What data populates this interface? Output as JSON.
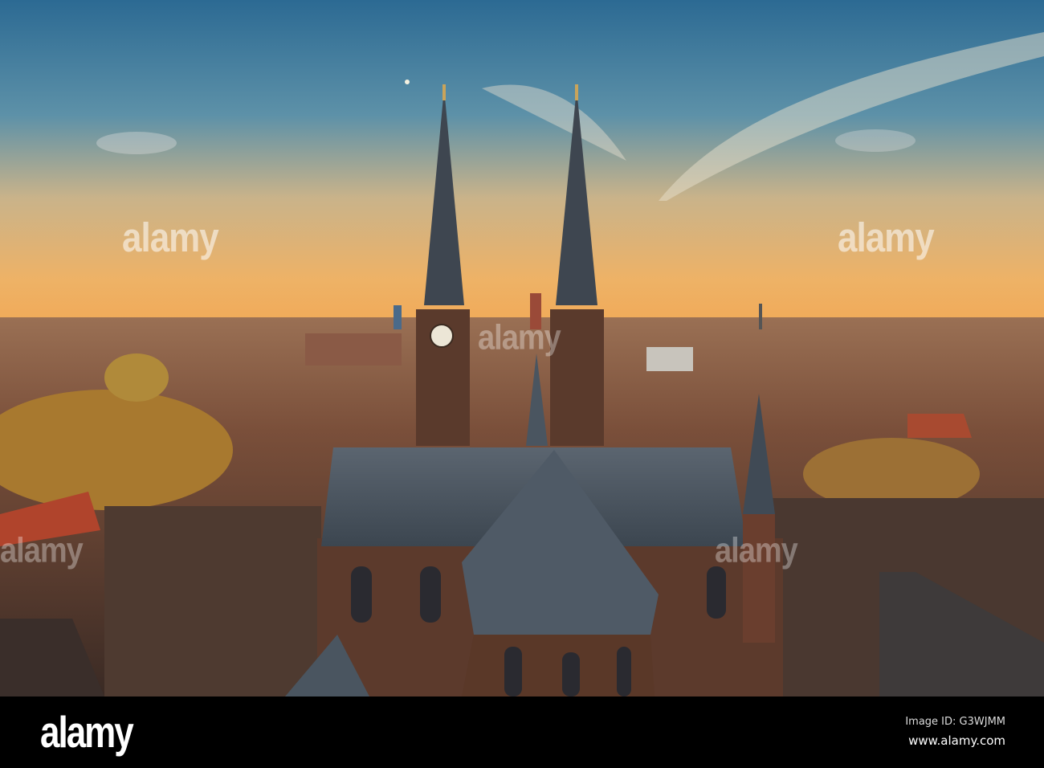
{
  "photo": {
    "subject": "church-with-twin-spires-over-city",
    "colors": {
      "sky_top": "#2f6f96",
      "sky_mid": "#8fa9a8",
      "horizon": "#f0b061",
      "roof": "#4a5560",
      "brick": "#5a3a2c",
      "trees": "#b07a2a"
    }
  },
  "watermark": {
    "text": "alamy"
  },
  "footer": {
    "logo": "alamy",
    "image_id": "Image ID: G3WJMM",
    "url": "www.alamy.com"
  }
}
